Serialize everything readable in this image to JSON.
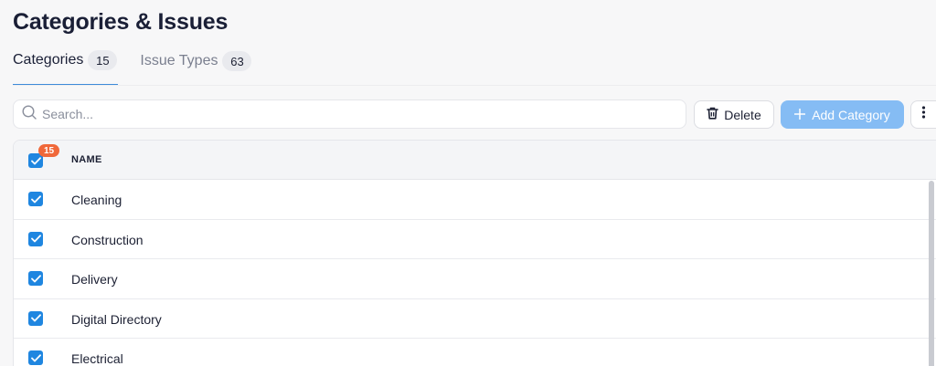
{
  "page": {
    "title": "Categories & Issues"
  },
  "tabs": [
    {
      "label": "Categories",
      "count": "15",
      "active": true
    },
    {
      "label": "Issue Types",
      "count": "63",
      "active": false
    }
  ],
  "toolbar": {
    "search_placeholder": "Search...",
    "delete_label": "Delete",
    "add_label": "Add Category"
  },
  "table": {
    "header": {
      "name": "NAME",
      "selected_count": "15"
    },
    "rows": [
      {
        "name": "Cleaning",
        "checked": true
      },
      {
        "name": "Construction",
        "checked": true
      },
      {
        "name": "Delivery",
        "checked": true
      },
      {
        "name": "Digital Directory",
        "checked": true
      },
      {
        "name": "Electrical",
        "checked": true
      }
    ]
  },
  "colors": {
    "accent": "#1f86e0",
    "add_button": "#85bcf4",
    "count_badge": "#f0683a"
  },
  "icons": {
    "search": "search-icon",
    "delete": "trash-icon",
    "add": "plus-icon",
    "more": "more-vertical-icon",
    "check": "check-icon"
  }
}
